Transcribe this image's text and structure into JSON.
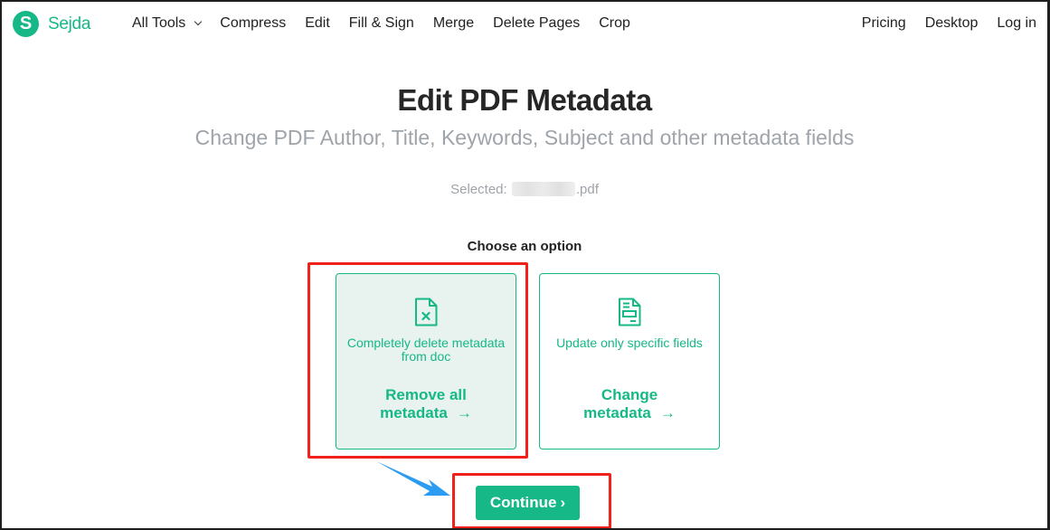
{
  "brand": {
    "name": "Sejda",
    "logo_letter": "S",
    "color": "#15b886"
  },
  "nav": {
    "links": [
      {
        "label": "All Tools",
        "has_dropdown": true
      },
      {
        "label": "Compress"
      },
      {
        "label": "Edit"
      },
      {
        "label": "Fill & Sign"
      },
      {
        "label": "Merge"
      },
      {
        "label": "Delete Pages"
      },
      {
        "label": "Crop"
      }
    ],
    "right_links": [
      {
        "label": "Pricing"
      },
      {
        "label": "Desktop"
      },
      {
        "label": "Log in"
      }
    ]
  },
  "page": {
    "title": "Edit PDF Metadata",
    "subtitle": "Change PDF Author, Title, Keywords, Subject and other metadata fields",
    "selected_label": "Selected:",
    "selected_file_ext": ".pdf",
    "choose_label": "Choose an option"
  },
  "options": [
    {
      "icon": "file-x-icon",
      "description": "Completely delete metadata from doc",
      "action_line1": "Remove all",
      "action_line2": "metadata",
      "arrow": "→",
      "selected": true
    },
    {
      "icon": "file-form-icon",
      "description": "Update only specific fields",
      "action_line1": "Change",
      "action_line2": "metadata",
      "arrow": "→",
      "selected": false
    }
  ],
  "continue_button": {
    "label": "Continue",
    "chevron": "›"
  },
  "annotations": {
    "highlight_color": "#f0201a",
    "arrow_color": "#2b9cf2"
  }
}
